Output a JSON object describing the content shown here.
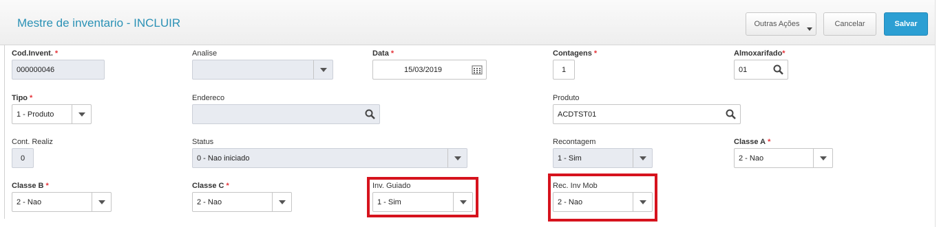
{
  "header": {
    "title": "Mestre de inventario - INCLUIR",
    "buttons": {
      "outras_acoes": "Outras Ações",
      "cancelar": "Cancelar",
      "salvar": "Salvar"
    }
  },
  "fields": {
    "cod_invent": {
      "label": "Cod.Invent.",
      "required": "*",
      "value": "000000046"
    },
    "analise": {
      "label": "Analise",
      "value": ""
    },
    "data": {
      "label": "Data",
      "required": "*",
      "value": "15/03/2019"
    },
    "contagens": {
      "label": "Contagens",
      "required": "*",
      "value": "1"
    },
    "almoxarifado": {
      "label": "Almoxarifado",
      "required": "*",
      "value": "01"
    },
    "tipo": {
      "label": "Tipo",
      "required": "*",
      "value": "1 - Produto"
    },
    "endereco": {
      "label": "Endereco",
      "value": ""
    },
    "produto": {
      "label": "Produto",
      "value": "ACDTST01"
    },
    "cont_realiz": {
      "label": "Cont. Realiz",
      "value": "0"
    },
    "status": {
      "label": "Status",
      "value": "0 - Nao iniciado"
    },
    "recontagem": {
      "label": "Recontagem",
      "value": "1 - Sim"
    },
    "classe_a": {
      "label": "Classe A",
      "required": "*",
      "value": "2 - Nao"
    },
    "classe_b": {
      "label": "Classe B",
      "required": "*",
      "value": "2 - Nao"
    },
    "classe_c": {
      "label": "Classe C",
      "required": "*",
      "value": "2 - Nao"
    },
    "inv_guiado": {
      "label": "Inv. Guiado",
      "value": "1 - Sim"
    },
    "rec_inv_mob": {
      "label": "Rec. Inv Mob",
      "value": "2 - Nao"
    }
  },
  "icons": {
    "search": "magnifier-icon",
    "calendar": "calendar-icon",
    "dropdown": "chevron-down-icon"
  },
  "colors": {
    "title": "#2a91b5",
    "primary_button": "#2c9fd3",
    "required": "#e53238",
    "highlight": "#d6131d",
    "readonly_field": "#e8ebf1"
  }
}
